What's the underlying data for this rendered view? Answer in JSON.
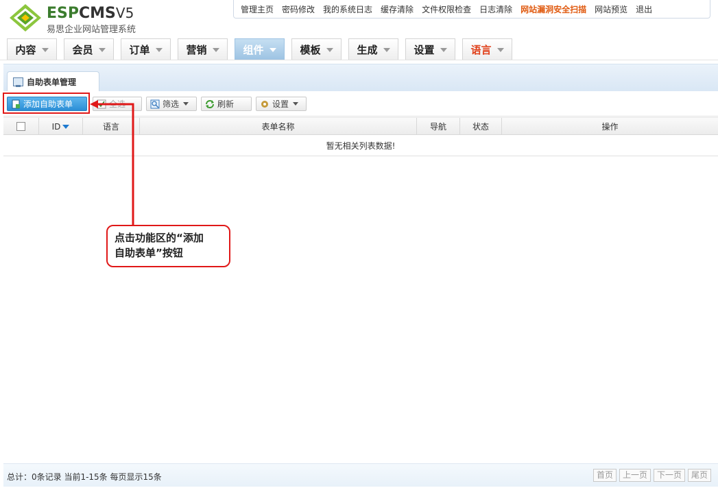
{
  "brand": {
    "name_esp": "ESP",
    "name_cms": "CMS",
    "version": "V5",
    "subtitle": "易思企业网站管理系统"
  },
  "topnav": [
    {
      "label": "管理主页",
      "highlight": false
    },
    {
      "label": "密码修改",
      "highlight": false
    },
    {
      "label": "我的系统日志",
      "highlight": false
    },
    {
      "label": "缓存清除",
      "highlight": false
    },
    {
      "label": "文件权限检查",
      "highlight": false
    },
    {
      "label": "日志清除",
      "highlight": false
    },
    {
      "label": "网站漏洞安全扫描",
      "highlight": true
    },
    {
      "label": "网站预览",
      "highlight": false
    },
    {
      "label": "退出",
      "highlight": false
    }
  ],
  "mainnav": [
    {
      "label": "内容",
      "active": false
    },
    {
      "label": "会员",
      "active": false
    },
    {
      "label": "订单",
      "active": false
    },
    {
      "label": "营销",
      "active": false
    },
    {
      "label": "组件",
      "active": true
    },
    {
      "label": "模板",
      "active": false
    },
    {
      "label": "生成",
      "active": false
    },
    {
      "label": "设置",
      "active": false
    },
    {
      "label": "语言",
      "active": false
    }
  ],
  "panel": {
    "tab_title": "自助表单管理"
  },
  "toolbar": {
    "add_label": "添加自助表单",
    "select_all_label": "全选",
    "filter_label": "筛选",
    "refresh_label": "刷新",
    "settings_label": "设置"
  },
  "table": {
    "columns": [
      "",
      "ID",
      "语言",
      "表单名称",
      "导航",
      "状态",
      "操作"
    ],
    "empty_message": "暂无相关列表数据!"
  },
  "callout": {
    "line1": "点击功能区的“添加",
    "line2": "自助表单”按钮"
  },
  "footer": {
    "info": "总计：0条记录 当前1-15条 每页显示15条",
    "pager": [
      "首页",
      "上一页",
      "下一页",
      "尾页"
    ]
  },
  "colors": {
    "accent_blue": "#2b8ed6",
    "highlight_red": "#e01818",
    "hot_link": "#e05a10",
    "brand_green": "#3b7c2e"
  }
}
